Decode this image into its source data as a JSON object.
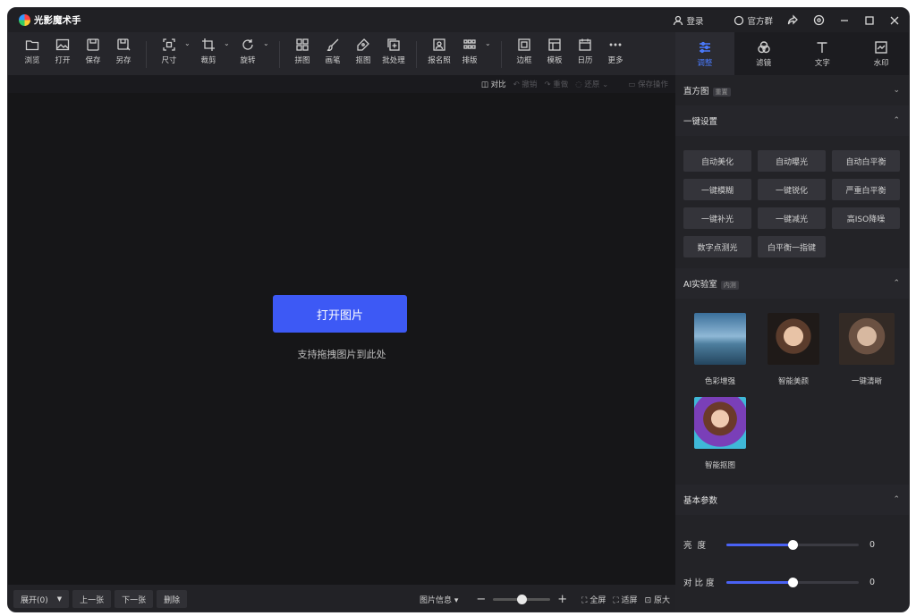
{
  "app": {
    "title": "光影魔术手"
  },
  "titlebar": {
    "login": "登录",
    "group": "官方群"
  },
  "toolbar": {
    "items": [
      {
        "label": "浏览",
        "icon": "folder-icon"
      },
      {
        "label": "打开",
        "icon": "image-open-icon"
      },
      {
        "label": "保存",
        "icon": "save-icon"
      },
      {
        "label": "另存",
        "icon": "save-as-icon"
      },
      {
        "label": "尺寸",
        "icon": "resize-icon"
      },
      {
        "label": "裁剪",
        "icon": "crop-icon"
      },
      {
        "label": "旋转",
        "icon": "rotate-icon"
      },
      {
        "label": "拼图",
        "icon": "collage-icon"
      },
      {
        "label": "画笔",
        "icon": "brush-icon"
      },
      {
        "label": "抠图",
        "icon": "cutout-pen-icon"
      },
      {
        "label": "批处理",
        "icon": "batch-icon"
      },
      {
        "label": "报名照",
        "icon": "id-photo-icon"
      },
      {
        "label": "排版",
        "icon": "layout-grid-icon"
      },
      {
        "label": "边框",
        "icon": "frame-icon"
      },
      {
        "label": "模板",
        "icon": "template-icon"
      },
      {
        "label": "日历",
        "icon": "calendar-icon"
      },
      {
        "label": "更多",
        "icon": "more-icon"
      }
    ]
  },
  "subbar": {
    "compare": "对比",
    "undo": "撤销",
    "redo": "重做",
    "restore": "还原",
    "save_op": "保存操作"
  },
  "canvas": {
    "open_button": "打开图片",
    "drop_hint": "支持拖拽图片到此处"
  },
  "bottom": {
    "expand": "展开(0)",
    "prev": "上一张",
    "next": "下一张",
    "delete": "删除",
    "info": "图片信息 ▾",
    "fullscreen": "全屏",
    "fit": "适屏",
    "original": "原大",
    "zoom_level": 0.5
  },
  "panel": {
    "tabs": [
      {
        "label": "调整",
        "icon": "sliders-icon",
        "active": true
      },
      {
        "label": "滤镜",
        "icon": "filter-icon",
        "active": false
      },
      {
        "label": "文字",
        "icon": "text-icon",
        "active": false
      },
      {
        "label": "水印",
        "icon": "watermark-icon",
        "active": false
      }
    ],
    "histogram": {
      "title": "直方图",
      "badge": "重置"
    },
    "oneclick": {
      "title": "一键设置",
      "buttons": [
        "自动美化",
        "自动曝光",
        "自动白平衡",
        "一键模糊",
        "一键锐化",
        "严重白平衡",
        "一键补光",
        "一键减光",
        "高ISO降噪",
        "数字点测光",
        "白平衡一指键"
      ]
    },
    "ai": {
      "title": "AI实验室",
      "badge": "内测",
      "items": [
        "色彩增强",
        "智能美颜",
        "一键清晰",
        "智能抠图"
      ]
    },
    "basic": {
      "title": "基本参数",
      "params": [
        {
          "label": "亮度",
          "value": "0",
          "level": 0.5
        },
        {
          "label": "对比度",
          "value": "0",
          "level": 0.5
        }
      ]
    }
  },
  "colors": {
    "accent": "#3d59f5",
    "active_tab": "#4a7bff",
    "background": "#1e1e22"
  }
}
